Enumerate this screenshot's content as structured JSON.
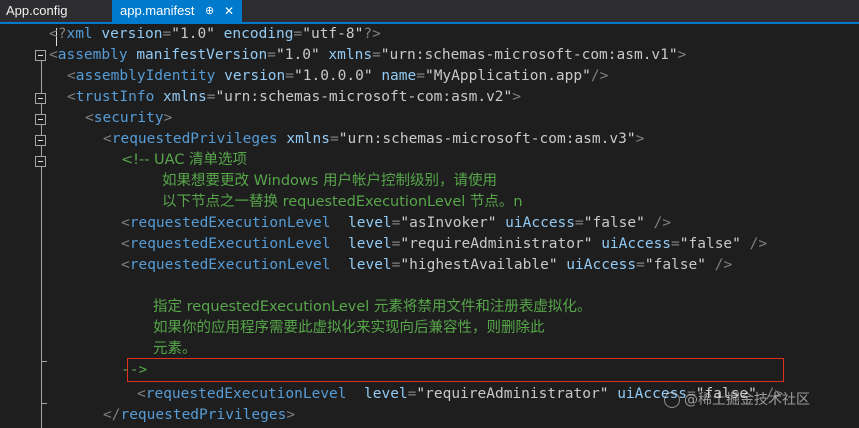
{
  "tabs": [
    {
      "label": "App.config",
      "active": false
    },
    {
      "label": "app.manifest",
      "active": true,
      "pin": "⊕",
      "close": "✕"
    }
  ],
  "colors": {
    "background": "#1e1e1e",
    "tab_active": "#007acc",
    "tag": "#569cd6",
    "attribute": "#92caf4",
    "value": "#c8c8c8",
    "delimiter": "#808080",
    "comment": "#57a64a",
    "highlight_border": "#e0301e"
  },
  "code": {
    "l1": {
      "open": "<?",
      "tag": "xml",
      "a1": "version",
      "v1": "1.0",
      "a2": "encoding",
      "v2": "utf-8",
      "close": "?>"
    },
    "l2": {
      "tag": "assembly",
      "a1": "manifestVersion",
      "v1": "1.0",
      "a2": "xmlns",
      "v2": "urn:schemas-microsoft-com:asm.v1"
    },
    "l3": {
      "tag": "assemblyIdentity",
      "a1": "version",
      "v1": "1.0.0.0",
      "a2": "name",
      "v2": "MyApplication.app"
    },
    "l4": {
      "tag": "trustInfo",
      "a1": "xmlns",
      "v1": "urn:schemas-microsoft-com:asm.v2"
    },
    "l5": {
      "tag": "security"
    },
    "l6": {
      "tag": "requestedPrivileges",
      "a1": "xmlns",
      "v1": "urn:schemas-microsoft-com:asm.v3"
    },
    "l7": {
      "text": "<!-- UAC 清单选项"
    },
    "l8": {
      "text": "如果想要更改 Windows 用户帐户控制级别，请使用"
    },
    "l9": {
      "text": "以下节点之一替换 requestedExecutionLevel 节点。n"
    },
    "l10": {
      "tag": "requestedExecutionLevel",
      "a1": "level",
      "v1": "asInvoker",
      "a2": "uiAccess",
      "v2": "false"
    },
    "l11": {
      "tag": "requestedExecutionLevel",
      "a1": "level",
      "v1": "requireAdministrator",
      "a2": "uiAccess",
      "v2": "false"
    },
    "l12": {
      "tag": "requestedExecutionLevel",
      "a1": "level",
      "v1": "highestAvailable",
      "a2": "uiAccess",
      "v2": "false"
    },
    "l14": {
      "text": "指定 requestedExecutionLevel 元素将禁用文件和注册表虚拟化。"
    },
    "l15": {
      "text": "如果你的应用程序需要此虚拟化来实现向后兼容性，则删除此"
    },
    "l16": {
      "text": "元素。"
    },
    "l17": {
      "text": "-->"
    },
    "l18": {
      "tag": "requestedExecutionLevel",
      "a1": "level",
      "v1": "requireAdministrator",
      "a2": "uiAccess",
      "v2": "false",
      "tail": "/>"
    },
    "l19": {
      "tag": "requestedPrivileges"
    }
  },
  "watermark": "@稀土掘金技术社区"
}
